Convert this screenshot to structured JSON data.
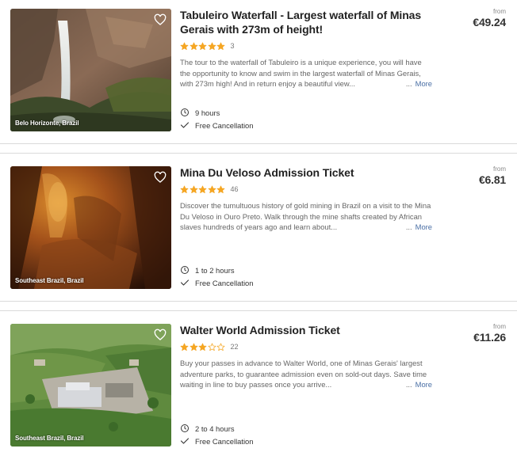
{
  "listings": [
    {
      "title": "Tabuleiro Waterfall - Largest waterfall of Minas Gerais with 273m of height!",
      "rating": 5,
      "reviews_count": "3",
      "description": "The tour to the waterfall of Tabuleiro is a unique experience, you will have the opportunity to know and swim in the largest waterfall of Minas Gerais, with 273m high! And in return enjoy a beautiful view...",
      "more_label": "More",
      "duration": "9 hours",
      "cancellation": "Free Cancellation",
      "location": "Belo Horizonte, Brazil",
      "from_label": "from",
      "price": "€49.24"
    },
    {
      "title": "Mina Du Veloso Admission Ticket",
      "rating": 5,
      "reviews_count": "46",
      "description": "Discover the tumultuous history of gold mining in Brazil on a visit to the Mina Du Veloso in Ouro Preto. Walk through the mine shafts created by African slaves hundreds of years ago and learn about...",
      "more_label": "More",
      "duration": "1 to 2 hours",
      "cancellation": "Free Cancellation",
      "location": "Southeast Brazil, Brazil",
      "from_label": "from",
      "price": "€6.81"
    },
    {
      "title": "Walter World Admission Ticket",
      "rating": 3,
      "reviews_count": "22",
      "description": "Buy your passes in advance to Walter World, one of Minas Gerais' largest adventure parks, to guarantee admission even on sold-out days. Save time waiting in line to buy passes once you arrive...",
      "more_label": "More",
      "duration": "2 to 4 hours",
      "cancellation": "Free Cancellation",
      "location": "Southeast Brazil, Brazil",
      "from_label": "from",
      "price": "€11.26"
    }
  ],
  "icons": {
    "star": "star-icon",
    "heart": "heart-icon",
    "clock": "clock-icon",
    "check": "check-icon"
  },
  "colors": {
    "star_filled": "#f5a623",
    "star_empty": "#f5a623",
    "link": "#4a6fa5",
    "title": "#222222",
    "divider": "#dadada"
  }
}
